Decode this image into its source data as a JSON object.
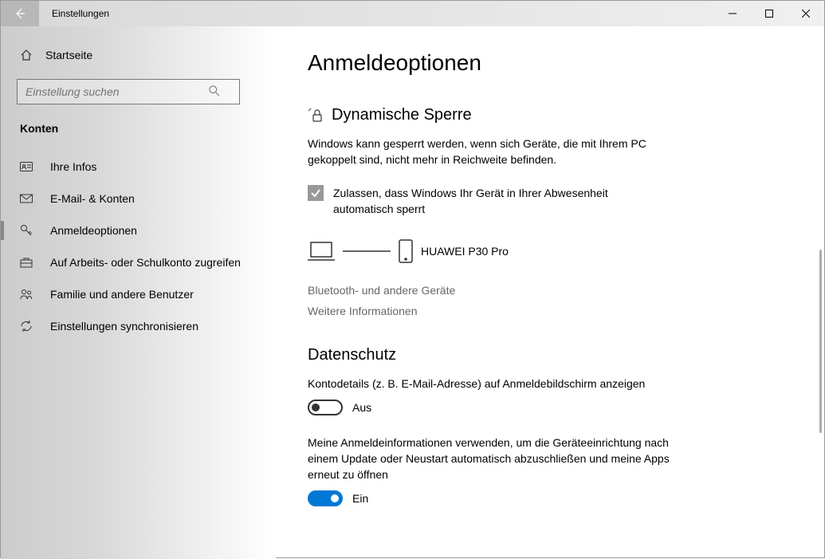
{
  "titlebar": {
    "title": "Einstellungen"
  },
  "sidebar": {
    "home": "Startseite",
    "search_placeholder": "Einstellung suchen",
    "category": "Konten",
    "items": [
      {
        "label": "Ihre Infos"
      },
      {
        "label": "E-Mail- & Konten"
      },
      {
        "label": "Anmeldeoptionen"
      },
      {
        "label": "Auf Arbeits- oder Schulkonto zugreifen"
      },
      {
        "label": "Familie und andere Benutzer"
      },
      {
        "label": "Einstellungen synchronisieren"
      }
    ]
  },
  "content": {
    "title": "Anmeldeoptionen",
    "dynlock": {
      "heading": "Dynamische Sperre",
      "desc": "Windows kann gesperrt werden, wenn sich Geräte, die mit Ihrem PC gekoppelt sind, nicht mehr in Reichweite befinden.",
      "checkbox_label": "Zulassen, dass Windows Ihr Gerät in Ihrer Abwesenheit automatisch sperrt",
      "device_name": "HUAWEI P30 Pro",
      "link1": "Bluetooth- und andere Geräte",
      "link2": "Weitere Informationen"
    },
    "privacy": {
      "heading": "Datenschutz",
      "setting1_desc": "Kontodetails (z. B. E-Mail-Adresse) auf Anmeldebildschirm anzeigen",
      "setting1_state": "Aus",
      "setting2_desc": "Meine Anmeldeinformationen verwenden, um die Geräteeinrichtung nach einem Update oder Neustart automatisch abzuschließen und meine Apps erneut zu öffnen",
      "setting2_state": "Ein"
    }
  }
}
